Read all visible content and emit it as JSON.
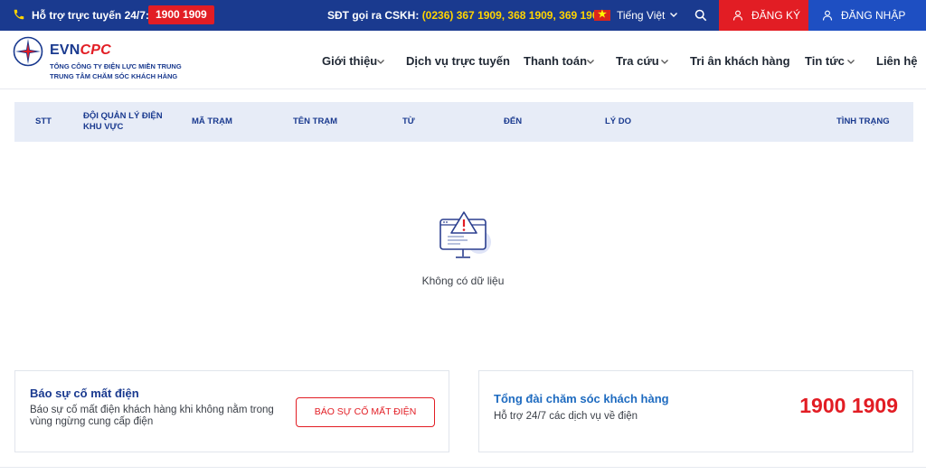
{
  "topbar": {
    "support_label": "Hỗ trợ trực tuyến 24/7:",
    "hotline": "1900 1909",
    "cskh_label": "SĐT gọi ra CSKH:",
    "cskh_numbers": "(0236) 367 1909, 368 1909, 369 1909",
    "language": "Tiếng Việt",
    "register_label": "ĐĂNG KÝ",
    "login_label": "ĐĂNG NHẬP"
  },
  "logo": {
    "brand_evn": "EVN",
    "brand_cpc": "CPC",
    "sub1": "TỔNG CÔNG TY ĐIỆN LỰC MIỀN TRUNG",
    "sub2": "TRUNG TÂM CHĂM SÓC KHÁCH HÀNG"
  },
  "nav": {
    "items": [
      "Giới thiệu",
      "Dịch vụ trực tuyến",
      "Thanh toán",
      "Tra cứu",
      "Tri ân khách hàng",
      "Tin tức",
      "Liên hệ"
    ]
  },
  "table": {
    "headers": [
      "STT",
      "ĐỘI QUẢN LÝ ĐIỆN",
      "KHU VỰC",
      "MÃ TRẠM",
      "TÊN TRẠM",
      "TỪ",
      "ĐẾN",
      "LÝ DO",
      "TÌNH TRẠNG"
    ],
    "empty_text": "Không có dữ liệu"
  },
  "outage_card": {
    "title": "Báo sự cố mất điện",
    "description": "Báo sự cố mất điện khách hàng khi không nằm trong vùng ngừng cung cấp điện",
    "button_label": "BÁO SỰ CỐ MẤT ĐIỆN"
  },
  "hotline_card": {
    "title": "Tổng đài chăm sóc khách hàng",
    "description": "Hỗ trợ 24/7 các dịch vụ về điện",
    "number": "1900 1909"
  },
  "colors": {
    "primary_navy": "#1a3a8f",
    "accent_red": "#e21d24",
    "login_blue": "#1e4fc2",
    "highlight_yellow": "#ffd400"
  },
  "icons": {
    "phone": "phone-icon",
    "flag": "vietnam-flag-icon",
    "search": "search-icon",
    "user": "user-icon",
    "chevron": "chevron-down-icon",
    "empty": "warning-monitor-icon"
  }
}
